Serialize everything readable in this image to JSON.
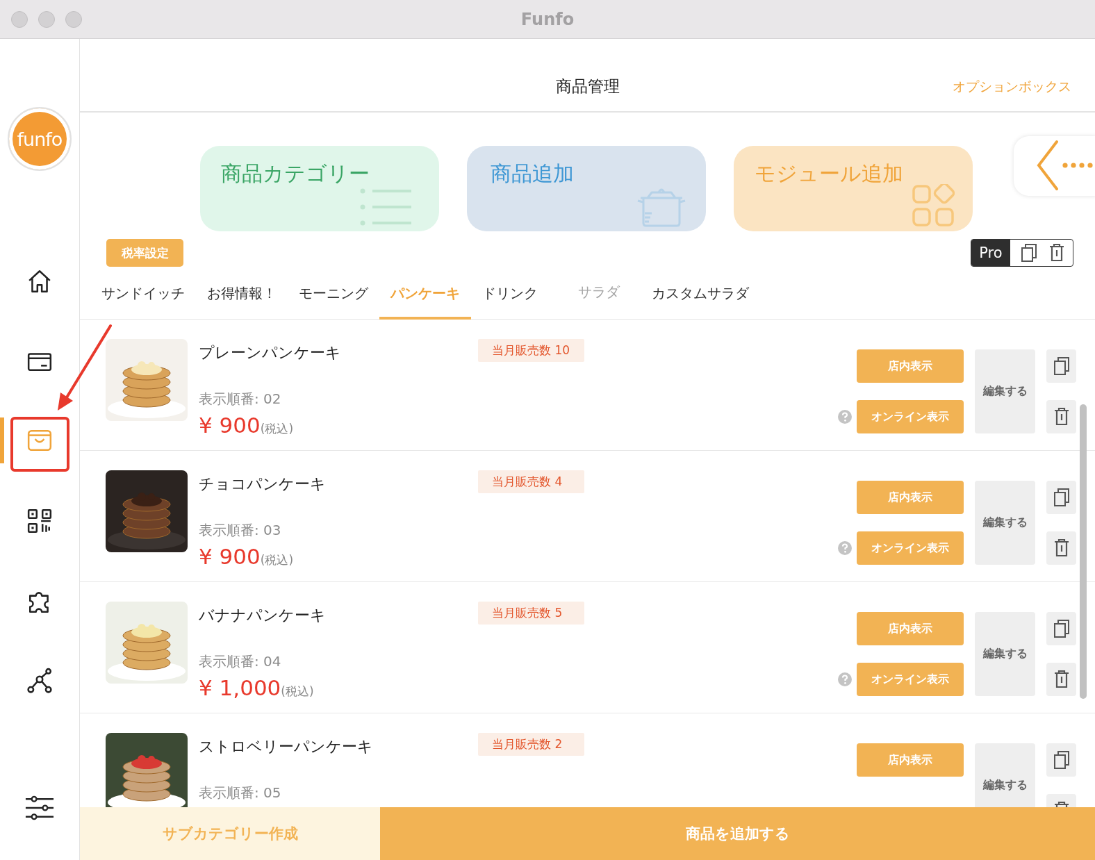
{
  "window": {
    "title": "Funfo"
  },
  "sidebar": {
    "logo": "funfo",
    "items": [
      {
        "kind": "home",
        "selected": false,
        "highlighted": false
      },
      {
        "kind": "card",
        "selected": false,
        "highlighted": false
      },
      {
        "kind": "bag",
        "selected": true,
        "highlighted": true
      },
      {
        "kind": "qr",
        "selected": false,
        "highlighted": false
      },
      {
        "kind": "puzzle",
        "selected": false,
        "highlighted": false
      },
      {
        "kind": "network",
        "selected": false,
        "highlighted": false
      },
      {
        "kind": "sliders",
        "selected": false,
        "highlighted": false
      }
    ]
  },
  "header": {
    "title": "商品管理",
    "option_link": "オプションボックス"
  },
  "shortcut_cards": [
    {
      "kind": "category",
      "label": "商品カテゴリー"
    },
    {
      "kind": "product",
      "label": "商品追加"
    },
    {
      "kind": "module",
      "label": "モジュール追加"
    }
  ],
  "tax_button": "税率設定",
  "toolbar": {
    "pro_label": "Pro"
  },
  "tabs": [
    {
      "label": "サンドイッチ",
      "selected": false,
      "disabled": false
    },
    {
      "label": "お得情報！",
      "selected": false,
      "disabled": false
    },
    {
      "label": "モーニング",
      "selected": false,
      "disabled": false
    },
    {
      "label": "パンケーキ",
      "selected": true,
      "disabled": false
    },
    {
      "label": "ドリンク",
      "selected": false,
      "disabled": false
    },
    {
      "label": "サラダ",
      "selected": false,
      "disabled": true
    },
    {
      "label": "カスタムサラダ",
      "selected": false,
      "disabled": false
    }
  ],
  "products": [
    {
      "name": "プレーンパンケーキ",
      "sales": "当月販売数 10",
      "order": "表示順番: 02",
      "price": "¥ 900",
      "tax_note": "(税込)",
      "store_button": "店内表示",
      "online_button": "オンライン表示",
      "edit_button": "編集する"
    },
    {
      "name": "チョコパンケーキ",
      "sales": "当月販売数 4",
      "order": "表示順番: 03",
      "price": "¥ 900",
      "tax_note": "(税込)",
      "store_button": "店内表示",
      "online_button": "オンライン表示",
      "edit_button": "編集する"
    },
    {
      "name": "バナナパンケーキ",
      "sales": "当月販売数 5",
      "order": "表示順番: 04",
      "price": "¥ 1,000",
      "tax_note": "(税込)",
      "store_button": "店内表示",
      "online_button": "オンライン表示",
      "edit_button": "編集する"
    },
    {
      "name": "ストロベリーパンケーキ",
      "sales": "当月販売数 2",
      "order": "表示順番: 05",
      "store_button": "店内表示",
      "edit_button": "編集する"
    }
  ],
  "footer": {
    "subcategory_button": "サブカテゴリー作成",
    "add_button": "商品を追加する"
  }
}
